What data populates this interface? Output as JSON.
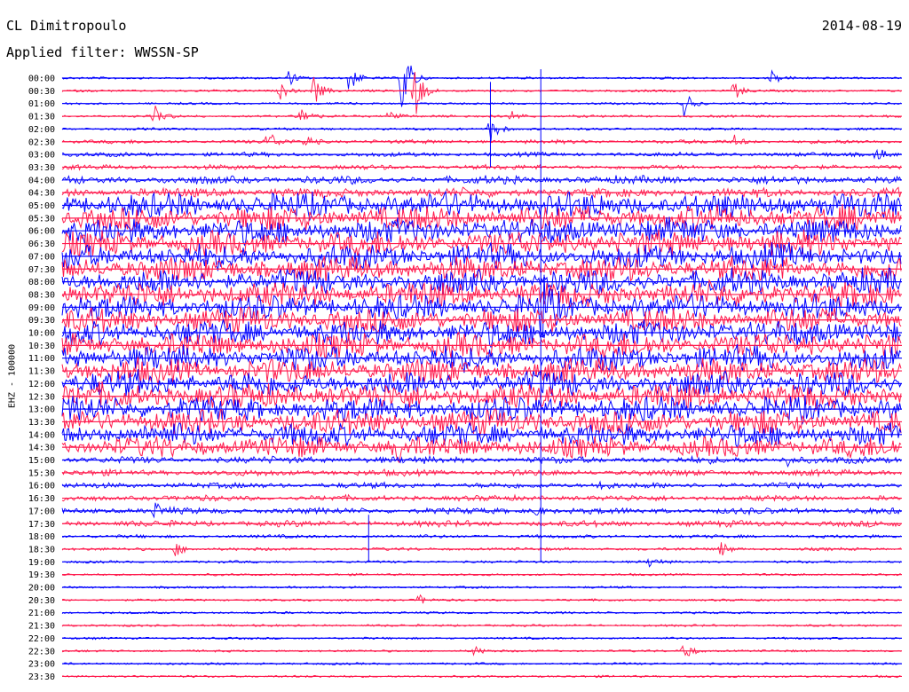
{
  "header": {
    "station": "CL Dimitropoulo",
    "date": "2014-08-19",
    "filter": "Applied filter: WWSSN-SP"
  },
  "channel_label": "EHZ - 100000",
  "colors": {
    "trace_a": "#0000ff",
    "trace_b": "#ff1a4d",
    "text": "#000000"
  },
  "chart_data": {
    "type": "line",
    "title": "CL Dimitropoulo",
    "ylabel": "EHZ - 100000",
    "xlabel": "",
    "row_labels": [
      "00:00",
      "00:30",
      "01:00",
      "01:30",
      "02:00",
      "02:30",
      "03:00",
      "03:30",
      "04:00",
      "04:30",
      "05:00",
      "05:30",
      "06:00",
      "06:30",
      "07:00",
      "07:30",
      "08:00",
      "08:30",
      "09:00",
      "09:30",
      "10:00",
      "10:30",
      "11:00",
      "11:30",
      "12:00",
      "12:30",
      "13:00",
      "13:30",
      "14:00",
      "14:30",
      "15:00",
      "15:30",
      "16:00",
      "16:30",
      "17:00",
      "17:30",
      "18:00",
      "18:30",
      "19:00",
      "19:30",
      "20:00",
      "20:30",
      "21:00",
      "21:30",
      "22:00",
      "22:30",
      "23:00",
      "23:30"
    ],
    "row_noise_level": [
      0.05,
      0.05,
      0.05,
      0.06,
      0.06,
      0.12,
      0.14,
      0.16,
      0.3,
      0.35,
      1.0,
      1.0,
      1.0,
      1.0,
      1.0,
      1.0,
      1.0,
      1.0,
      1.0,
      1.0,
      1.0,
      1.0,
      1.0,
      1.0,
      1.0,
      1.0,
      1.0,
      1.0,
      0.9,
      0.8,
      0.25,
      0.22,
      0.2,
      0.2,
      0.22,
      0.22,
      0.1,
      0.08,
      0.06,
      0.05,
      0.05,
      0.05,
      0.05,
      0.05,
      0.05,
      0.05,
      0.05,
      0.05
    ],
    "events": [
      {
        "row": 0,
        "x": 0.27,
        "amp": 0.6
      },
      {
        "row": 0,
        "x": 0.34,
        "amp": 1.4
      },
      {
        "row": 0,
        "x": 0.405,
        "amp": 3.5
      },
      {
        "row": 0,
        "x": 0.845,
        "amp": 0.6
      },
      {
        "row": 1,
        "x": 0.26,
        "amp": 0.7
      },
      {
        "row": 1,
        "x": 0.3,
        "amp": 1.2
      },
      {
        "row": 1,
        "x": 0.42,
        "amp": 2.5
      },
      {
        "row": 1,
        "x": 0.8,
        "amp": 0.8
      },
      {
        "row": 2,
        "x": 0.74,
        "amp": 1.1
      },
      {
        "row": 3,
        "x": 0.11,
        "amp": 0.9
      },
      {
        "row": 3,
        "x": 0.285,
        "amp": 0.8
      },
      {
        "row": 3,
        "x": 0.39,
        "amp": 0.8
      },
      {
        "row": 3,
        "x": 0.535,
        "amp": 0.5
      },
      {
        "row": 4,
        "x": 0.51,
        "amp": 1.2
      },
      {
        "row": 5,
        "x": 0.245,
        "amp": 0.9
      },
      {
        "row": 5,
        "x": 0.29,
        "amp": 0.6
      },
      {
        "row": 5,
        "x": 0.8,
        "amp": 0.5
      },
      {
        "row": 6,
        "x": 0.97,
        "amp": 0.7
      },
      {
        "row": 18,
        "x": 0.57,
        "amp": 3.0
      },
      {
        "row": 29,
        "x": 0.4,
        "amp": 1.0
      },
      {
        "row": 30,
        "x": 0.86,
        "amp": 0.6
      },
      {
        "row": 32,
        "x": 0.64,
        "amp": 0.6
      },
      {
        "row": 34,
        "x": 0.11,
        "amp": 0.6
      },
      {
        "row": 34,
        "x": 0.56,
        "amp": 0.6
      },
      {
        "row": 37,
        "x": 0.135,
        "amp": 0.6
      },
      {
        "row": 37,
        "x": 0.785,
        "amp": 0.6
      },
      {
        "row": 38,
        "x": 0.7,
        "amp": 0.5
      },
      {
        "row": 41,
        "x": 0.425,
        "amp": 0.4
      },
      {
        "row": 45,
        "x": 0.49,
        "amp": 0.4
      },
      {
        "row": 45,
        "x": 0.74,
        "amp": 0.9
      }
    ],
    "spikes": [
      {
        "row": 0,
        "x": 0.57,
        "from_row": 0,
        "to_row": 38
      },
      {
        "row": 2,
        "x": 0.51,
        "from_row": 1,
        "to_row": 7
      },
      {
        "row": 38,
        "x": 0.365,
        "from_row": 35,
        "to_row": 38
      }
    ]
  }
}
